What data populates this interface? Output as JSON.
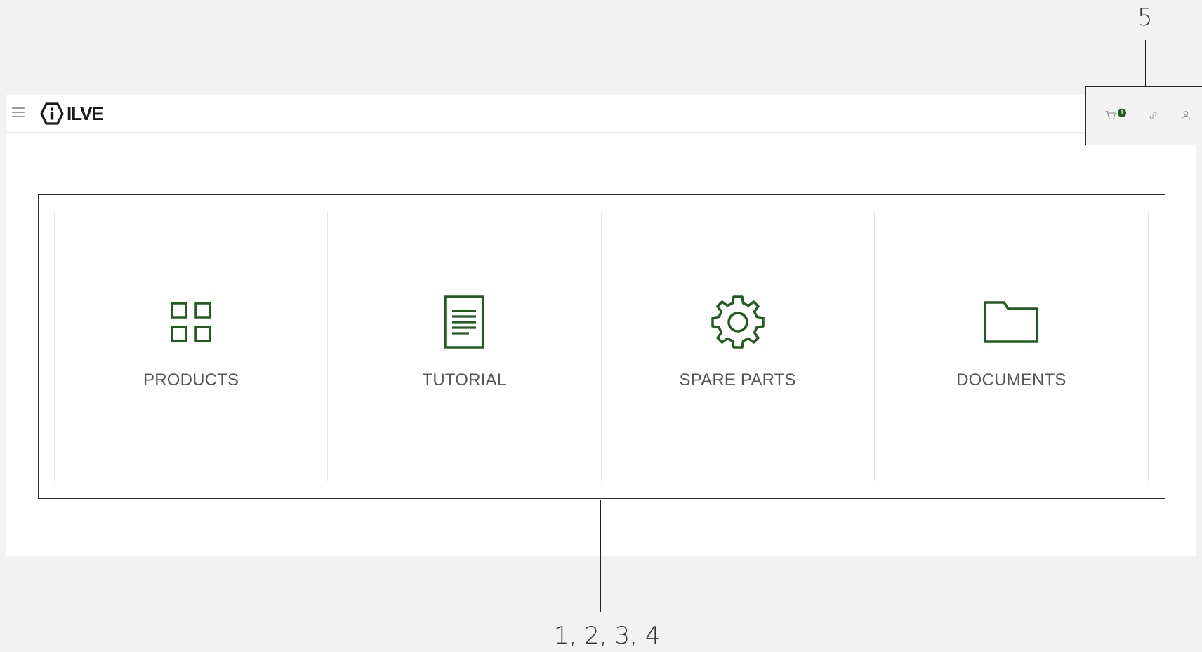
{
  "callouts": {
    "top": "5",
    "bottom": "1, 2, 3, 4"
  },
  "header": {
    "logo_text": "ILVE",
    "cart_count": "1"
  },
  "tiles": [
    {
      "label": "PRODUCTS",
      "icon": "grid-icon"
    },
    {
      "label": "TUTORIAL",
      "icon": "document-icon"
    },
    {
      "label": "SPARE PARTS",
      "icon": "gear-icon"
    },
    {
      "label": "DOCUMENTS",
      "icon": "folder-icon"
    }
  ],
  "colors": {
    "accent": "#1f5e1f",
    "label": "#555555",
    "background": "#f2f2f3"
  }
}
